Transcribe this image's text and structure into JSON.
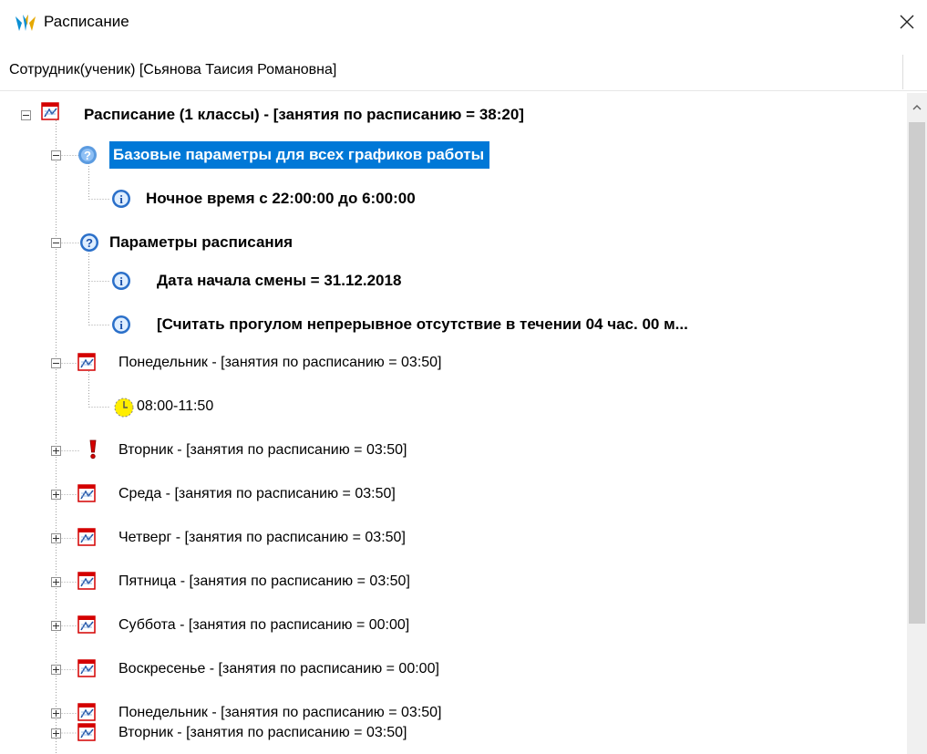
{
  "window": {
    "title": "Расписание",
    "app_icon": "app-logo-icon",
    "close_icon": "close-icon"
  },
  "header": {
    "text": "Сотрудник(ученик) [Сьянова Таисия Романовна]"
  },
  "tree": {
    "root": {
      "label": "Расписание (1 классы) - [занятия по расписанию = 38:20]",
      "icon": "calendar-icon",
      "expanded": true
    },
    "base_params": {
      "label": "Базовые параметры для всех графиков работы",
      "icon": "question-icon",
      "selected": true,
      "children": [
        {
          "label": "Ночное время с 22:00:00 до 6:00:00",
          "icon": "info-icon"
        }
      ]
    },
    "schedule_params": {
      "label": "Параметры расписания",
      "icon": "question-icon",
      "children": [
        {
          "label": "Дата начала смены = 31.12.2018",
          "icon": "info-icon"
        },
        {
          "label": "[Считать прогулом непрерывное отсутствие в течении 04 час. 00 м...",
          "icon": "info-icon"
        }
      ]
    },
    "days": [
      {
        "label": "Понедельник - [занятия по расписанию = 03:50]",
        "icon": "calendar-icon",
        "expanded": true,
        "children": [
          {
            "label": "08:00-11:50",
            "icon": "clock-icon"
          }
        ]
      },
      {
        "label": "Вторник - [занятия по расписанию = 03:50]",
        "icon": "exclamation-icon",
        "expanded": false
      },
      {
        "label": "Среда - [занятия по расписанию = 03:50]",
        "icon": "calendar-icon",
        "expanded": false
      },
      {
        "label": "Четверг - [занятия по расписанию = 03:50]",
        "icon": "calendar-icon",
        "expanded": false
      },
      {
        "label": "Пятница - [занятия по расписанию = 03:50]",
        "icon": "calendar-icon",
        "expanded": false
      },
      {
        "label": "Суббота - [занятия по расписанию = 00:00]",
        "icon": "calendar-icon",
        "expanded": false
      },
      {
        "label": "Воскресенье - [занятия по расписанию = 00:00]",
        "icon": "calendar-icon",
        "expanded": false
      },
      {
        "label": "Понедельник - [занятия по расписанию = 03:50]",
        "icon": "calendar-icon",
        "expanded": false
      },
      {
        "label": "Вторник - [занятия по расписанию = 03:50]",
        "icon": "calendar-icon",
        "expanded": false
      }
    ]
  },
  "colors": {
    "selection": "#0078d7",
    "calendar_red": "#d40000",
    "info_blue": "#2a6fc9",
    "clock_yellow": "#ffee00"
  }
}
